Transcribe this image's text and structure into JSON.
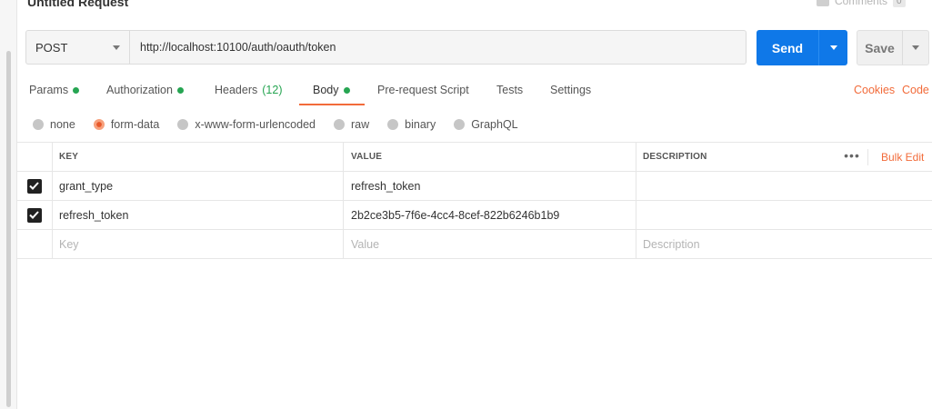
{
  "request": {
    "title": "Untitled Request",
    "comments_label": "Comments",
    "comments_count": "0"
  },
  "url_bar": {
    "method": "POST",
    "url": "http://localhost:10100/auth/oauth/token"
  },
  "actions": {
    "send_label": "Send",
    "save_label": "Save"
  },
  "tabs": [
    {
      "label": "Params",
      "dot": true
    },
    {
      "label": "Authorization",
      "dot": true
    },
    {
      "label": "Headers",
      "count": "(12)"
    },
    {
      "label": "Body",
      "dot": true,
      "active": true
    },
    {
      "label": "Pre-request Script"
    },
    {
      "label": "Tests"
    },
    {
      "label": "Settings"
    }
  ],
  "links": {
    "cookies": "Cookies",
    "code": "Code"
  },
  "body_types": [
    {
      "label": "none",
      "selected": false
    },
    {
      "label": "form-data",
      "selected": true
    },
    {
      "label": "x-www-form-urlencoded",
      "selected": false
    },
    {
      "label": "raw",
      "selected": false
    },
    {
      "label": "binary",
      "selected": false
    },
    {
      "label": "GraphQL",
      "selected": false
    }
  ],
  "table": {
    "headers": {
      "key": "KEY",
      "value": "VALUE",
      "description": "DESCRIPTION"
    },
    "more": "•••",
    "bulk_edit": "Bulk Edit",
    "rows": [
      {
        "checked": true,
        "key": "grant_type",
        "value": "refresh_token",
        "description": ""
      },
      {
        "checked": true,
        "key": "refresh_token",
        "value": "2b2ce3b5-7f6e-4cc4-8cef-822b6246b1b9",
        "description": ""
      }
    ],
    "placeholders": {
      "key": "Key",
      "value": "Value",
      "description": "Description"
    }
  },
  "colors": {
    "accent": "#f26b3a",
    "send": "#0f78e8",
    "status_dot": "#26a552"
  }
}
